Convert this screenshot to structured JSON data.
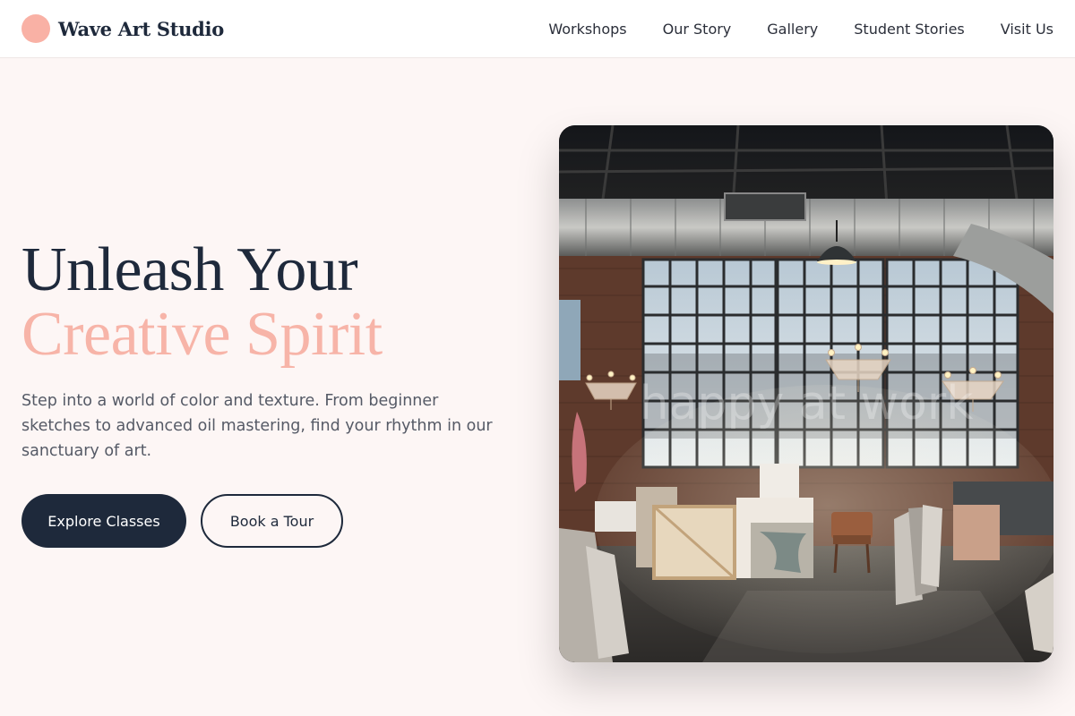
{
  "brand": {
    "name": "Wave Art Studio",
    "logo_color": "#f9b1a5"
  },
  "nav": {
    "items": [
      {
        "label": "Workshops"
      },
      {
        "label": "Our Story"
      },
      {
        "label": "Gallery"
      },
      {
        "label": "Student Stories"
      },
      {
        "label": "Visit Us"
      }
    ]
  },
  "hero": {
    "headline_line1": "Unleash Your",
    "headline_line2": "Creative Spirit",
    "description": "Step into a world of color and texture. From beginner sketches to advanced oil mastering, find your rhythm in our sanctuary of art.",
    "primary_cta": "Explore Classes",
    "secondary_cta": "Book a Tour",
    "image_overlay_text": "happy at work"
  },
  "colors": {
    "background": "#fdf6f5",
    "dark": "#1e293b",
    "accent": "#f7b4a8"
  }
}
